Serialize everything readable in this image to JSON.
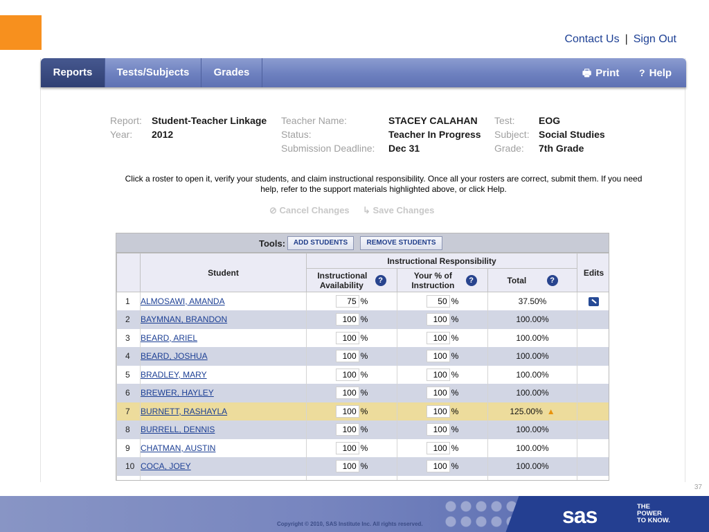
{
  "top_links": {
    "contact": "Contact Us",
    "separator": "|",
    "signout": "Sign Out"
  },
  "nav": {
    "tabs": [
      "Reports",
      "Tests/Subjects",
      "Grades"
    ],
    "print": "Print",
    "help": "Help"
  },
  "report_meta": {
    "report_label": "Report:",
    "report_value": "Student-Teacher Linkage",
    "year_label": "Year:",
    "year_value": "2012",
    "teacher_label": "Teacher Name:",
    "teacher_value": "STACEY CALAHAN",
    "status_label": "Status:",
    "status_value": "Teacher In Progress",
    "deadline_label": "Submission Deadline:",
    "deadline_value": "Dec 31",
    "test_label": "Test:",
    "test_value": "EOG",
    "subject_label": "Subject:",
    "subject_value": "Social Studies",
    "grade_label": "Grade:",
    "grade_value": "7th Grade"
  },
  "instructions": {
    "line1": "Click a roster to open it, verify your students, and claim instructional responsibility. Once all your rosters are correct, submit them. If you need",
    "line2": "help, refer to the support materials highlighted above, or click Help."
  },
  "changes": {
    "cancel": "Cancel Changes",
    "save": "Save Changes"
  },
  "tools": {
    "label": "Tools:",
    "add": "ADD STUDENTS",
    "remove": "REMOVE STUDENTS"
  },
  "table": {
    "student_header": "Student",
    "ir_header": "Instructional Responsibility",
    "avail_header": "Instructional Availability",
    "percent_header": "Your % of Instruction",
    "total_header": "Total",
    "edits_header": "Edits",
    "help_glyph": "?",
    "pct_sign": "%",
    "rows": [
      {
        "num": "1",
        "name": "ALMOSAWI, AMANDA",
        "avail": "75",
        "pct": "50",
        "total": "37.50%"
      },
      {
        "num": "2",
        "name": "BAYMNAN, BRANDON",
        "avail": "100",
        "pct": "100",
        "total": "100.00%"
      },
      {
        "num": "3",
        "name": "BEARD, ARIEL",
        "avail": "100",
        "pct": "100",
        "total": "100.00%"
      },
      {
        "num": "4",
        "name": "BEARD, JOSHUA",
        "avail": "100",
        "pct": "100",
        "total": "100.00%"
      },
      {
        "num": "5",
        "name": "BRADLEY, MARY",
        "avail": "100",
        "pct": "100",
        "total": "100.00%"
      },
      {
        "num": "6",
        "name": "BREWER, HAYLEY",
        "avail": "100",
        "pct": "100",
        "total": "100.00%"
      },
      {
        "num": "7",
        "name": "BURNETT, RASHAYLA",
        "avail": "100",
        "pct": "100",
        "total": "125.00%"
      },
      {
        "num": "8",
        "name": "BURRELL, DENNIS",
        "avail": "100",
        "pct": "100",
        "total": "100.00%"
      },
      {
        "num": "9",
        "name": "CHATMAN, AUSTIN",
        "avail": "100",
        "pct": "100",
        "total": "100.00%"
      },
      {
        "num": "10",
        "name": "COCA, JOEY",
        "avail": "100",
        "pct": "100",
        "total": "100.00%"
      }
    ]
  },
  "footer": {
    "copyright": "Copyright © 2010, SAS Institute Inc. All rights reserved.",
    "logo": "sas",
    "slogan_1": "THE",
    "slogan_2": "POWER",
    "slogan_3": "TO KNOW.",
    "page_number": "37"
  },
  "colors": {
    "accent_orange": "#f7901e",
    "nav_blue": "#6d80bf",
    "link_blue": "#1c3f94",
    "warn_row": "#eddc9c"
  }
}
